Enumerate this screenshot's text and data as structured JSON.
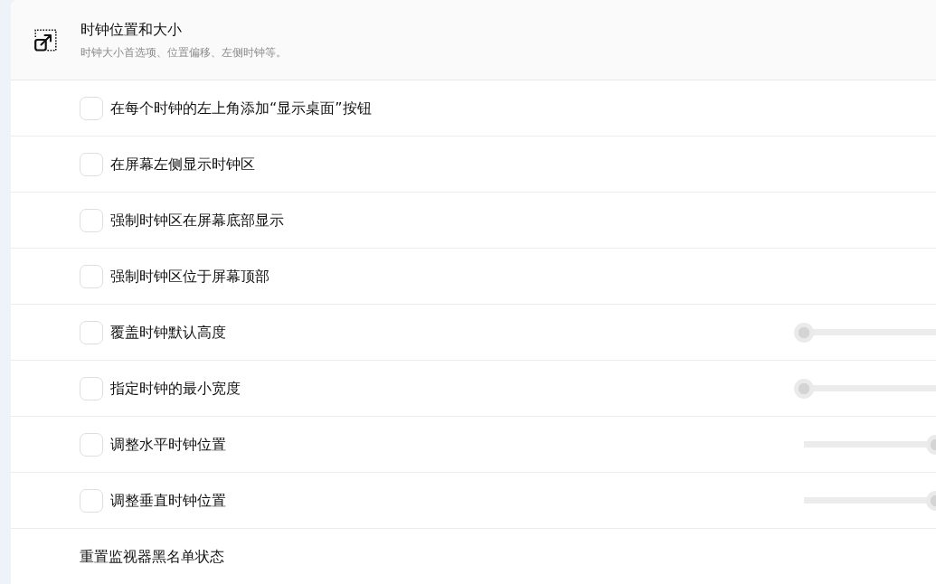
{
  "header": {
    "title": "时钟位置和大小",
    "subtitle": "时钟大小首选项、位置偏移、左侧时钟等。"
  },
  "settings": [
    {
      "kind": "checkbox",
      "label": "在每个时钟的左上角添加“显示桌面”按钮",
      "checked": false
    },
    {
      "kind": "checkbox",
      "label": "在屏幕左侧显示时钟区",
      "checked": false
    },
    {
      "kind": "checkbox",
      "label": "强制时钟区在屏幕底部显示",
      "checked": false
    },
    {
      "kind": "checkbox",
      "label": "强制时钟区位于屏幕顶部",
      "checked": false
    },
    {
      "kind": "slider",
      "label": "覆盖时钟默认高度",
      "checked": false,
      "level": 0
    },
    {
      "kind": "slider",
      "label": "指定时钟的最小宽度",
      "checked": false,
      "level": 0
    },
    {
      "kind": "slider",
      "label": "调整水平时钟位置",
      "checked": false,
      "level": 1
    },
    {
      "kind": "slider",
      "label": "调整垂直时钟位置",
      "checked": false,
      "level": 1
    },
    {
      "kind": "action",
      "label": "重置监视器黑名单状态"
    }
  ]
}
